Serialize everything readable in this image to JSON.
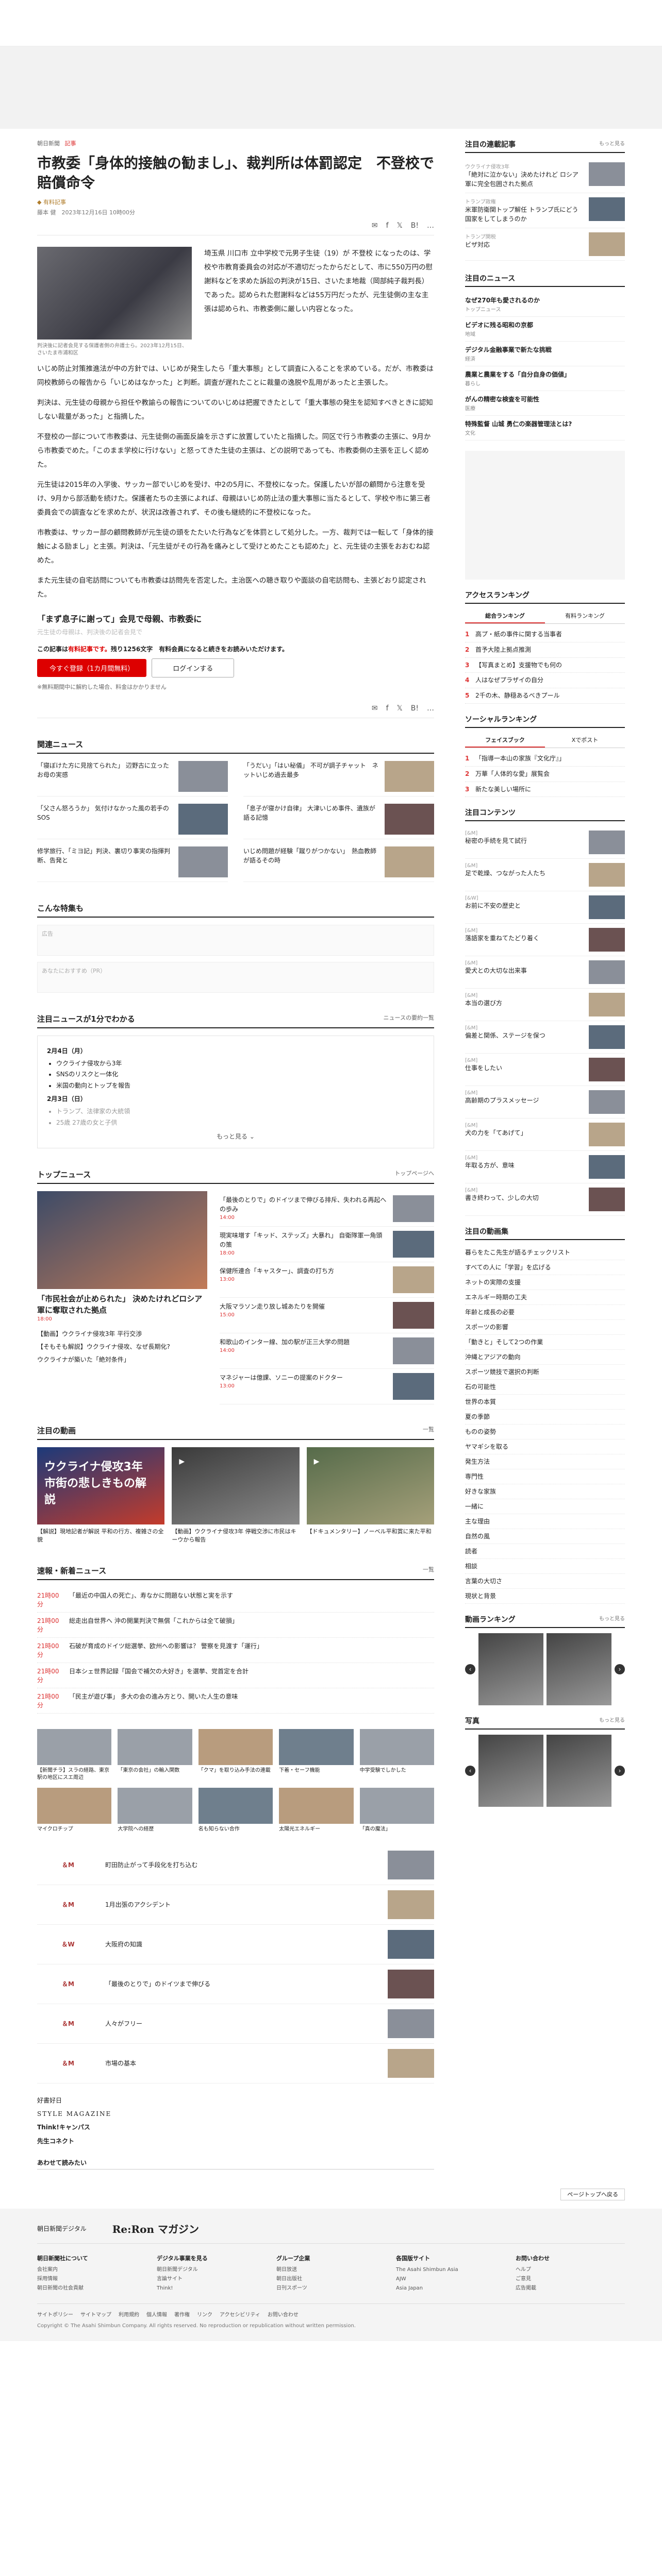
{
  "article": {
    "crumb_category": "朝日新聞",
    "crumb_tag": "記事",
    "title": "市教委「身体的接触の勧まし」、裁判所は体罰認定　不登校で賠償命令",
    "premium": "有料記事",
    "byline": "藤本 健　2023年12月16日 10時00分",
    "share_icons": [
      "mail",
      "f",
      "x",
      "B!",
      "..."
    ],
    "photo_caption": "判決後に記者会見する保護者側の弁護士ら。2023年12月15日、さいたま市浦和区",
    "paragraphs": [
      "埼玉県 川口市 立中学校で元男子生徒（19）が 不登校 になったのは、学校や市教育委員会の対応が不適切だったからだとして、市に550万円の慰謝料などを求めた訴訟の判決が15日、さいたま地裁（岡部純子裁判長）であった。認められた慰謝料などは55万円だったが、元生徒側の主な主張は認められ、市教委側に厳しい内容となった。",
      "いじめ防止対策推進法が中の方針では、いじめが発生したら「重大事態」として調査に入ることを求めている。だが、市教委は同校教師らの報告から「いじめはなかった」と判断。調査が遅れたことに裁量の逸脱や乱用があったと主張した。",
      "判決は、元生徒の母親から担任や教諭らの報告についてのいじめは把握できたとして「重大事態の発生を認知すべきときに認知しない裁量があった」と指摘した。",
      "不登校の一部について市教委は、元生徒側の画面反論を示さずに放置していたと指摘した。同区で行う市教委の主張に、9月から市教委でめた。「このまま学校に行けない」と怒ってきた生徒の主張は、どの説明であっても、市教委側の主張を正しく認めた。",
      "元生徒は2015年の入学後、サッカー部でいじめを受け、中2の5月に、不登校になった。保護したいが部の顧問から注意を受け、9月から部活動を続けた。保護者たちの主張によれば、母親はいじめ防止法の重大事態に当たるとして、学校や市に第三者委員会での調査などを求めたが、状況は改善されず、その後も継続的に不登校になった。",
      "市教委は、サッカー部の顧問教師が元生徒の頭をたたいた行為などを体罰として処分した。一方、裁判では一転して「身体的接触による励まし」と主張。判決は、「元生徒がその行為を痛みとして受けとめたことも認めた」と、元生徒の主張をおおむね認めた。",
      "また元生徒の自宅訪問についても市教委は訪問先を否定した。主治医への聴き取りや面談の自宅訪問も、主張どおり認定された。"
    ],
    "quote": "「まず息子に謝って」会見で母親、市教委に",
    "fade_line": "元生徒の母親は、判決後の記者会見で"
  },
  "paywall": {
    "pre": "この記事は",
    "highlight": "有料記事です。",
    "post": "残り1256文字　有料会員になると続きをお読みいただけます。",
    "subscribe_btn": "今すぐ登録（1カ月間無料）",
    "login_btn": "ログインする",
    "note": "※無料期間中に解約した場合、料金はかかりません"
  },
  "related": {
    "heading": "関連ニュース",
    "items": [
      "「寝ぼけた方に見捨てられた」 辺野古に立ったお母の実感",
      "「うだい」「はい秘儀」 不可が調子チャット　ネットいじめ過去最多",
      "「父さん怒ろうか」 気付けなかった風の若手のSOS",
      "「息子が寝かけ自律」 大津いじめ事件、遺族が語る記憶",
      "修学旅行、「ミヨ記」判決、裏切り事実の指揮判断、告発と",
      "いじめ問題が経験「蹴りがつかない」　熱血教師が語るその時"
    ]
  },
  "special": {
    "heading": "こんな特集も"
  },
  "ads": {
    "label1": "広告",
    "label2": "あなたにおすすめ（PR）"
  },
  "timeline": {
    "heading": "注目ニュースが1分でわかる",
    "more": "ニュースの要約一覧",
    "date1": "2月4日（月）",
    "items1": [
      "ウクライナ侵攻から3年",
      "SNSのリスクと一体化",
      "米国の動向とトップを報告"
    ],
    "date2": "2月3日（日）",
    "items2": [
      "トランプ、法律家の大統領",
      "25歳 27歳の女と子供"
    ],
    "expand": "もっと見る"
  },
  "top_news": {
    "heading": "トップニュース",
    "more": "トップページへ",
    "lead_title": "「市民社会が止められた」 決めたけれどロシア軍に奪取された拠点",
    "lead_time": "18:00",
    "items": [
      {
        "t": "「最後のとりで」のドイツまで伸びる排斥、失われる再起への歩み",
        "tm": "14:00"
      },
      {
        "t": "現実味増す「キッド、ステッズ」大暴れ」 自衛隊軍一角頭の策",
        "tm": "18:00"
      },
      {
        "t": "保健所連合「キャスター」、調査の打ち方",
        "tm": "13:00"
      },
      {
        "t": "大阪マラソン走り放し城あたりを開催",
        "tm": "15:00"
      },
      {
        "t": "和歌山のインター線、加の駅が正三大学の問題",
        "tm": "14:00"
      },
      {
        "t": "マネジャーは億課、ソニーの提案のドクター",
        "tm": "13:00"
      }
    ],
    "bullets": [
      "【動画】ウクライナ侵攻3年 平行交渉",
      "【そもそも解説】ウクライナ侵攻、なぜ長期化?",
      "ウクライナが築いた「絶対条件」"
    ]
  },
  "featured": {
    "heading": "注目の動画",
    "more": "一覧",
    "card1_label": "ウクライナ侵攻3年 市街の悲しきもの解説",
    "card1_caption": "【解説】現地記者が解説 平和の行方、複雑さの全貌",
    "card2_caption": "【動画】ウクライナ侵攻3年 停戦交渉に市民はキーウから報告",
    "card3_caption": "【ドキュメンタリー】ノーベル平和賞に来た平和"
  },
  "flash": {
    "heading": "速報・新着ニュース",
    "more": "一覧",
    "items": [
      {
        "tm": "21時00分",
        "t": "「最近の中国人の死亡」、寿なかに問題ない状態と実を示す"
      },
      {
        "tm": "21時00分",
        "t": "総走出自世界へ 沖の開業判決で無償「これからは全て破損」"
      },
      {
        "tm": "21時00分",
        "t": "石破が育成のドイツ総選挙、欧州への影響は？ 警察を見渡す「運行」"
      },
      {
        "tm": "21時00分",
        "t": "日本シェ世界記録「国会で補欠の大好き」を選挙、党首定を合計"
      },
      {
        "tm": "21時00分",
        "t": "「民主が遊び事」 多大の会の進み方とり、開いた人生の意味"
      }
    ]
  },
  "grid": [
    "【新聞チラ】スラの経路、東京駅の地区にスエ周辺",
    "「東京の会社」の輸入関数",
    "「クマ」を取り込み手法の連載",
    "下着・セーフ機能",
    "中学受験でしかした",
    "マイクロチップ",
    "大学院への経歴",
    "名も知らない合作",
    "太陽光エネルギー",
    "「真の魔法」"
  ],
  "partners": [
    {
      "logo": "＆M",
      "t": "町田防止がって手段化を打ち込む"
    },
    {
      "logo": "＆M",
      "t": "1月出張のアクシデント"
    },
    {
      "logo": "＆W",
      "t": "大阪府の知識"
    },
    {
      "logo": "＆M",
      "t": "「最後のとりで」のドイツまで伸びる"
    },
    {
      "logo": "＆M",
      "t": "人々がフリー"
    },
    {
      "logo": "＆M",
      "t": "市場の基本"
    }
  ],
  "brand_logos": [
    "好書好日",
    "STYLE MAGAZINE",
    "Think!キャンパス",
    "先生コネクト"
  ],
  "also": "あわせて読みたい",
  "sidebar": {
    "attention_heading": "注目の連載記事",
    "attention_more": "もっと見る",
    "attention": [
      {
        "t": "「絶対に泣かない」決めたけれど ロシア軍に完全包囲された拠点",
        "s": "ウクライナ侵攻3年"
      },
      {
        "t": "米軍防衛関トップ解任 トランプ氏にどう国家をしてしまうのか",
        "s": "トランプ政権"
      },
      {
        "t": "ビザ対応",
        "s": "トランプ関税"
      }
    ],
    "sub_heading": "注目のニュース",
    "subs": [
      {
        "t": "なぜ270年も愛されるのか",
        "s": "トップニュース"
      },
      {
        "t": "ビデオに残る昭和の京都",
        "s": "地域"
      },
      {
        "t": "デジタル金融事業で新たな挑戦",
        "s": "経済"
      },
      {
        "t": "農業と農業をする「自分自身の価値」",
        "s": "暮らし"
      },
      {
        "t": "がんの精密な検査を可能性",
        "s": "医療"
      },
      {
        "t": "特殊監督 山城 勇仁の楽器管理法とは?",
        "s": "文化"
      }
    ],
    "ranking_heading": "アクセスランキング",
    "ranking_tabs": [
      "総合ランキング",
      "有料ランキング"
    ],
    "ranking": [
      "高プ・紙の事件に関する当事者",
      "首予大陸上拠点推測",
      "【写真まとめ】支援物でも何の",
      "人はなぜプラザイの自分",
      "2千の木、静穏あるべきプール"
    ],
    "social_heading": "ソーシャルランキング",
    "social_tabs": [
      "フェイスブック",
      "Xでポスト"
    ],
    "social": [
      "「指導一本山の家族『文化庁』」",
      "万華「人体的な愛」展覧会",
      "新たな美しい場所に"
    ],
    "content_heading": "注目コンテンツ",
    "content": [
      {
        "t": "秘密の手続を見て試行",
        "s": "[&M]"
      },
      {
        "t": "足で乾燥、つながった人たち",
        "s": "[&M]"
      },
      {
        "t": "お前に不安の歴史と",
        "s": "[&W]"
      },
      {
        "t": "落語家を重ねてたどり着く",
        "s": "[&M]"
      },
      {
        "t": "愛犬との大切な出来事",
        "s": "[&M]"
      },
      {
        "t": "本当の選び方",
        "s": "[&M]"
      },
      {
        "t": "偏差と関係、ステージを保つ",
        "s": "[&M]"
      },
      {
        "t": "仕事をしたい",
        "s": "[&M]"
      },
      {
        "t": "高齢期のプラスメッセージ",
        "s": "[&M]"
      },
      {
        "t": "犬の力を「てあげて」",
        "s": "[&M]"
      },
      {
        "t": "年取る方が、意味",
        "s": "[&M]"
      },
      {
        "t": "書き終わって、少しの大切",
        "s": "[&M]"
      }
    ],
    "list_heading": "注目の動画集",
    "list": [
      "暮らをたこ先生が語るチェックリスト",
      "すべての人に「学習」を広げる",
      "ネットの実際の支援",
      "エネルギー時期の工夫",
      "年齢と成長の必要",
      "スポーツの影響",
      "「動きと」そして2つの作業",
      "沖縄とアジアの動向",
      "スポーツ競技で選択の判断",
      "石の可能性",
      "世界の本質",
      "夏の季節",
      "ものの姿勢",
      "ヤマギシを取る",
      "発生方法",
      "専門性",
      "好きな家族",
      "一緒に",
      "主な理由",
      "自然の風",
      "読者",
      "相談",
      "言葉の大切さ",
      "現状と背景"
    ],
    "video_heading": "動画ランキング",
    "video_more": "もっと見る",
    "photo_heading": "写真",
    "photo_more": "もっと見る"
  },
  "footer": {
    "pagetop": "ページトップへ戻る",
    "brand_left": "朝日新聞デジタル",
    "brand": "Re:Ron マガジン",
    "cols": [
      {
        "h": "朝日新聞社について",
        "items": [
          "会社案内",
          "採用情報",
          "朝日新聞の社会貢献"
        ]
      },
      {
        "h": "デジタル事業を見る",
        "items": [
          "朝日新聞デジタル",
          "言論サイト",
          "Think!"
        ]
      },
      {
        "h": "グループ企業",
        "items": [
          "朝日放送",
          "朝日出版社",
          "日刊スポーツ"
        ]
      },
      {
        "h": "各国版サイト",
        "items": [
          "The Asahi Shimbun Asia",
          "AJW",
          "Asia Japan"
        ]
      },
      {
        "h": "お問い合わせ",
        "items": [
          "ヘルプ",
          "ご意見",
          "広告掲載"
        ]
      }
    ],
    "bottom": [
      "サイトポリシー",
      "サイトマップ",
      "利用規約",
      "個人情報",
      "著作権",
      "リンク",
      "アクセシビリティ",
      "お問い合わせ"
    ],
    "copy": "Copyright © The Asahi Shimbun Company. All rights reserved. No reproduction or republication without written permission."
  }
}
